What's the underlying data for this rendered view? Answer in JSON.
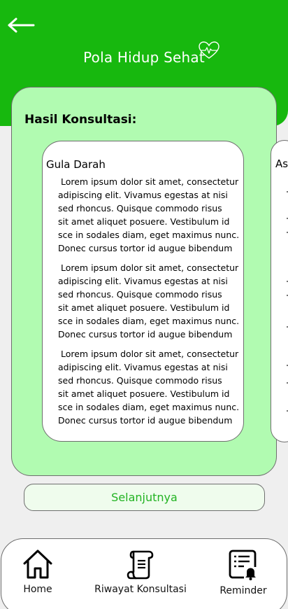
{
  "header": {
    "title": "Pola Hidup Sehat",
    "back_icon": "arrow-left-icon",
    "logo_icon": "heart-pulse-icon",
    "color": "#17b80e"
  },
  "card": {
    "heading": "Hasil Konsultasi:",
    "color": "#b1fbb1",
    "results": [
      {
        "title": "Gula Darah",
        "paragraphs": [
          [
            " Lorem ipsum dolor sit amet, consectetur",
            "adipiscing elit. Vivamus egestas at nisi",
            "sed rhoncus. Quisque commodo risus",
            "sit amet aliquet posuere. Vestibulum id",
            "sce in sodales diam, eget maximus nunc.",
            "Donec cursus tortor id augue bibendum"
          ],
          [
            " Lorem ipsum dolor sit amet, consectetur",
            "adipiscing elit. Vivamus egestas at nisi",
            "sed rhoncus. Quisque commodo risus",
            "sit amet aliquet posuere. Vestibulum id",
            "sce in sodales diam, eget maximus nunc.",
            "Donec cursus tortor id augue bibendum"
          ],
          [
            " Lorem ipsum dolor sit amet, consectetur",
            "adipiscing elit. Vivamus egestas at nisi",
            "sed rhoncus. Quisque commodo risus",
            "sit amet aliquet posuere. Vestibulum id",
            "sce in sodales diam, eget maximus nunc.",
            "Donec cursus tortor id augue bibendum"
          ]
        ]
      },
      {
        "title": "Asa"
      }
    ]
  },
  "next_button": {
    "label": "Selanjutnya",
    "text_color": "#22b322"
  },
  "bottom_nav": {
    "items": [
      {
        "label": "Home",
        "icon": "home-icon"
      },
      {
        "label": "Riwayat Konsultasi",
        "icon": "scroll-icon"
      },
      {
        "label": "Reminder",
        "icon": "checklist-bell-icon"
      }
    ]
  }
}
